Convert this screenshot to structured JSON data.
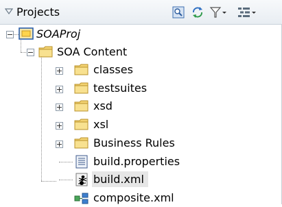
{
  "panel": {
    "title": "Projects",
    "toolbar": [
      "find-icon",
      "sync-icon",
      "filter-icon",
      "layout-icon"
    ]
  },
  "tree": {
    "project": {
      "label": "SOAProj",
      "icon": "project-icon",
      "expanded": true
    },
    "content": {
      "label": "SOA Content",
      "icon": "folder-icon",
      "expanded": true
    },
    "children": [
      {
        "label": "classes",
        "icon": "folder-icon",
        "expandable": true
      },
      {
        "label": "testsuites",
        "icon": "folder-icon",
        "expandable": true
      },
      {
        "label": "xsd",
        "icon": "folder-icon",
        "expandable": true
      },
      {
        "label": "xsl",
        "icon": "folder-icon",
        "expandable": true
      },
      {
        "label": "Business Rules",
        "icon": "folder-icon",
        "expandable": true
      },
      {
        "label": "build.properties",
        "icon": "properties-file-icon",
        "expandable": false
      },
      {
        "label": "build.xml",
        "icon": "ant-build-icon",
        "expandable": false,
        "selected": true
      },
      {
        "label": "composite.xml",
        "icon": "composite-icon",
        "expandable": false
      }
    ]
  },
  "colors": {
    "selection": "#e6e6e6",
    "folder": "#f3d373",
    "header": "#e8edf2"
  }
}
